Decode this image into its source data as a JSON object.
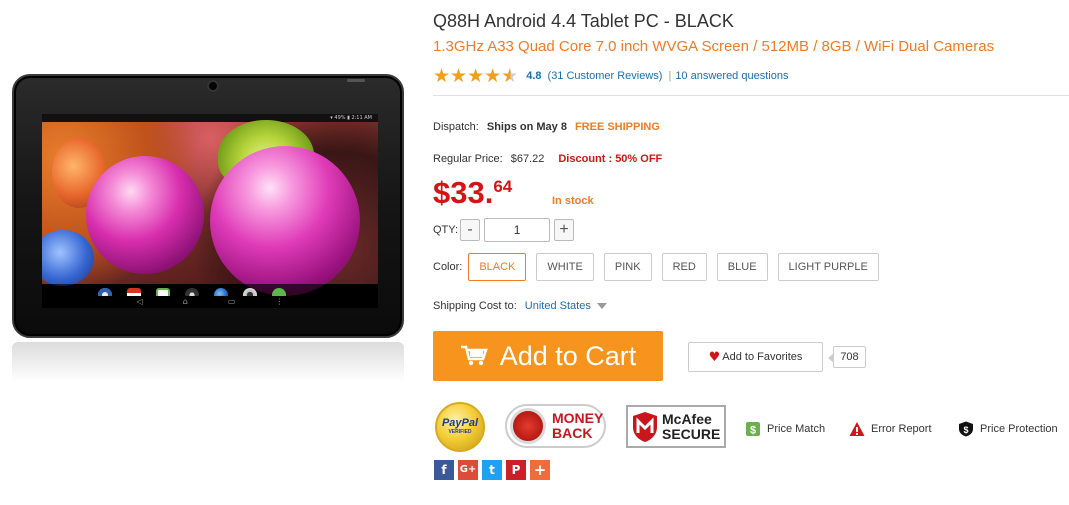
{
  "product": {
    "title": "Q88H Android 4.4 Tablet PC  -  BLACK",
    "subtitle": "1.3GHz A33 Quad Core 7.0 inch WVGA Screen / 512MB / 8GB / WiFi Dual Cameras"
  },
  "image": {
    "status_text": "▾ 49% ▮ 2:11 AM",
    "nav_back": "◁",
    "nav_home": "⌂",
    "nav_recent": "▭",
    "nav_menu": "⋮"
  },
  "rating": {
    "stars": 4.5,
    "value": "4.8",
    "reviews": "(31 Customer Reviews)",
    "separator": "|",
    "questions": "10 answered questions"
  },
  "dispatch": {
    "label": "Dispatch:",
    "ships": "Ships on May 8",
    "free": "FREE SHIPPING"
  },
  "pricing": {
    "regular_label": "Regular Price:",
    "regular_value": "$67.22",
    "discount": "Discount : 50% OFF",
    "price_main": "$33.",
    "price_cents": "64",
    "stock": "In stock"
  },
  "quantity": {
    "label": "QTY:",
    "minus": "-",
    "value": "1",
    "plus": "+"
  },
  "colors": {
    "label": "Color:",
    "options": [
      "BLACK",
      "WHITE",
      "PINK",
      "RED",
      "BLUE",
      "LIGHT PURPLE"
    ],
    "selected": "BLACK"
  },
  "shipping": {
    "label": "Shipping Cost to:",
    "country": "United States"
  },
  "actions": {
    "add_to_cart": "Add to Cart",
    "add_to_favorites": "Add to Favorites",
    "favorites_count": "708"
  },
  "badges": {
    "paypal": "PayPal",
    "paypal_sub": "VERIFIED",
    "money_line1": "MONEY",
    "money_line2": "BACK",
    "mcafee_line1": "McAfee",
    "mcafee_line2": "SECURE"
  },
  "assurances": {
    "price_match": "Price Match",
    "error_report": "Error Report",
    "price_protection": "Price Protection"
  },
  "social": {
    "facebook": "f",
    "google": "G+",
    "twitter": "t",
    "pinterest": "P",
    "more": "+"
  },
  "colors_theme": {
    "accent_orange": "#f7941d",
    "price_red": "#d31515",
    "link_blue": "#1a6fb0",
    "star_gold": "#f2a01c"
  }
}
